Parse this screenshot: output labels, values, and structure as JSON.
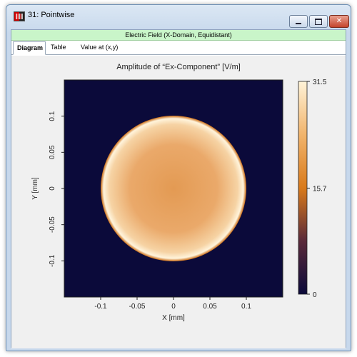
{
  "window": {
    "title": "31: Pointwise",
    "minimize_icon": "minimize-icon",
    "maximize_icon": "maximize-icon",
    "close_icon": "close-icon"
  },
  "header": {
    "label": "Electric Field (X-Domain, Equidistant)"
  },
  "tabs": [
    {
      "label": "Diagram",
      "active": true
    },
    {
      "label": "Table",
      "active": false
    },
    {
      "label": "Value at (x,y)",
      "active": false
    }
  ],
  "chart_data": {
    "type": "heatmap",
    "title": "Amplitude of “Ex-Component”  [V/m]",
    "xlabel": "X [mm]",
    "ylabel": "Y [mm]",
    "xlim": [
      -0.15,
      0.15
    ],
    "ylim": [
      -0.15,
      0.15
    ],
    "x_ticks": [
      "-0.1",
      "-0.05",
      "0",
      "0.05",
      "0.1"
    ],
    "x_tick_values": [
      -0.1,
      -0.05,
      0,
      0.05,
      0.1
    ],
    "y_ticks": [
      "0.1",
      "0.05",
      "0",
      "-0.05",
      "-0.1"
    ],
    "y_tick_values": [
      0.1,
      0.05,
      0,
      -0.05,
      -0.1
    ],
    "colorbar": {
      "min": 0,
      "max": 31.5,
      "tick_labels": [
        "31.5",
        "15.7",
        "0"
      ],
      "tick_values": [
        31.5,
        15.7,
        0
      ]
    },
    "feature": {
      "shape": "circular disc",
      "center": [
        0,
        0
      ],
      "radius_mm": 0.1,
      "inside_value_approx": 20,
      "edge_value_max": 31.5,
      "outside_value": 0
    },
    "colors": {
      "background": "#0b0a3a",
      "low": "#0b0a3a",
      "mid": "#e08a2a",
      "high": "#fff3d8"
    }
  }
}
